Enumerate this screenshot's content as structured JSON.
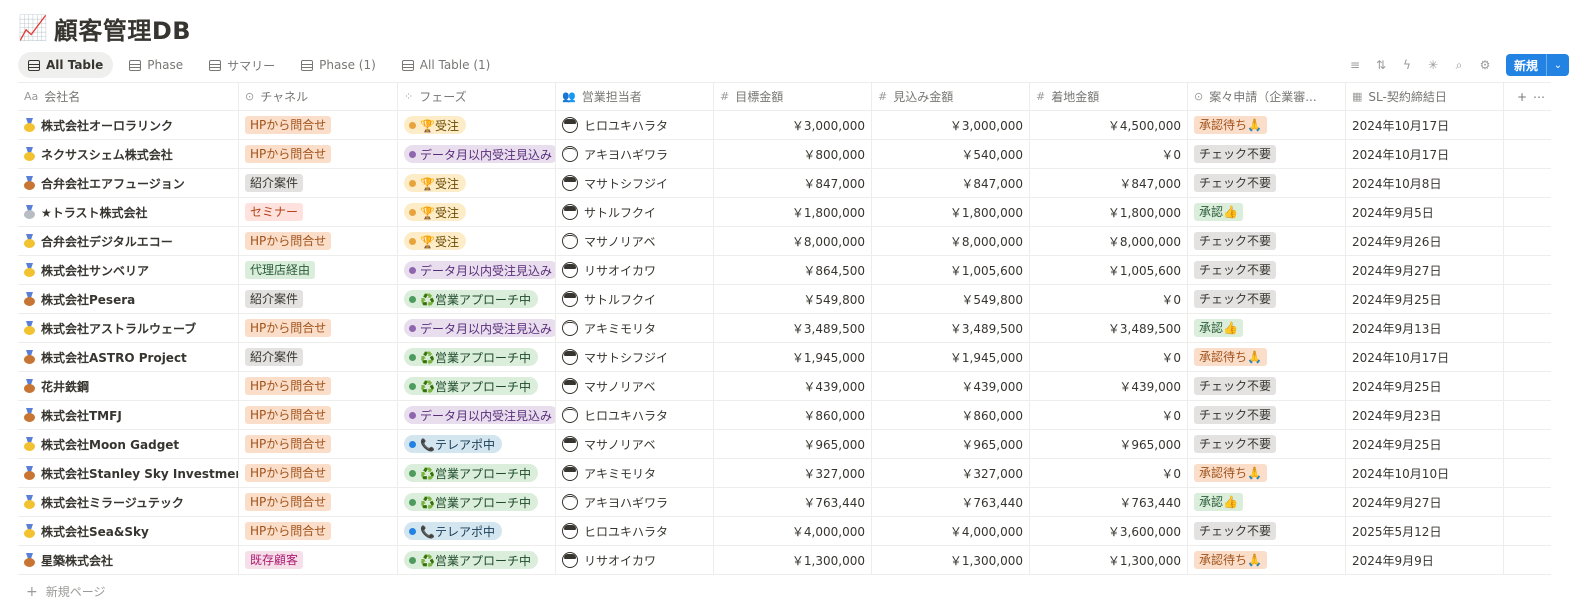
{
  "page": {
    "title_emoji": "📈",
    "title": "顧客管理DB"
  },
  "tabs": [
    {
      "label": "All Table",
      "active": true
    },
    {
      "label": "Phase",
      "active": false
    },
    {
      "label": "サマリー",
      "active": false
    },
    {
      "label": "Phase (1)",
      "active": false
    },
    {
      "label": "All Table (1)",
      "active": false
    }
  ],
  "toolbar": {
    "new_label": "新規",
    "icons": [
      "filter-icon",
      "sort-icon",
      "automation-icon",
      "ai-icon",
      "search-icon",
      "settings-icon"
    ]
  },
  "columns": [
    {
      "label": "会社名",
      "icon": "Aa"
    },
    {
      "label": "チャネル",
      "icon": "⊙"
    },
    {
      "label": "フェーズ",
      "icon": "⁘"
    },
    {
      "label": "営業担当者",
      "icon": "👥"
    },
    {
      "label": "目標金額",
      "icon": "#"
    },
    {
      "label": "見込み金額",
      "icon": "#"
    },
    {
      "label": "着地金額",
      "icon": "#"
    },
    {
      "label": "案々申請（企業審...",
      "icon": "⊙"
    },
    {
      "label": "SL-契約締結日",
      "icon": "▦"
    }
  ],
  "colors": {
    "channel": {
      "HPから問合せ": [
        "#fadec9",
        "#a0521b"
      ],
      "紹介案件": [
        "#e3e2e0",
        "#37352f"
      ],
      "セミナー": [
        "#ffe2dd",
        "#b4451c"
      ],
      "代理店経由": [
        "#dbeddb",
        "#2b5d38"
      ],
      "既存顧客": [
        "#f5e0e9",
        "#ad1a72"
      ]
    },
    "phase": {
      "受注": [
        "#fdecc8",
        "#6b4a00",
        "#e8a33c"
      ],
      "データ月以内受注見込み": [
        "#e8deee",
        "#5a2d7a",
        "#9065b0"
      ],
      "営業アプローチ中": [
        "#dbeddb",
        "#1e4a2a",
        "#4d9b5d"
      ],
      "テレアポ中": [
        "#d3e5ef",
        "#183b56",
        "#2383e2"
      ]
    },
    "approval": {
      "承認待ち🙏": [
        "#fadec9",
        "#a0521b"
      ],
      "チェック不要": [
        "#e3e2e0",
        "#37352f"
      ],
      "承認👍": [
        "#dbeddb",
        "#2b5d38"
      ]
    }
  },
  "rows": [
    {
      "medal": "gold",
      "company": "株式会社オーロラリンク",
      "channel": "HPから問合せ",
      "phase_key": "受注",
      "phase_label": "🏆受注",
      "rep": "ヒロユキハラタ",
      "target": "￥3,000,000",
      "forecast": "￥3,000,000",
      "landing": "￥4,500,000",
      "approval": "承認待ち🙏",
      "date": "2024年10月17日"
    },
    {
      "medal": "gold",
      "company": "ネクサスシェム株式会社",
      "channel": "HPから問合せ",
      "phase_key": "データ月以内受注見込み",
      "phase_label": "データ月以内受注見込み",
      "rep": "アキヨハギワラ",
      "target": "￥800,000",
      "forecast": "￥540,000",
      "landing": "￥0",
      "approval": "チェック不要",
      "date": "2024年10月17日"
    },
    {
      "medal": "bronze",
      "company": "合弁会社エアフュージョン",
      "channel": "紹介案件",
      "phase_key": "受注",
      "phase_label": "🏆受注",
      "rep": "マサトシフジイ",
      "target": "￥847,000",
      "forecast": "￥847,000",
      "landing": "￥847,000",
      "approval": "チェック不要",
      "date": "2024年10月8日"
    },
    {
      "medal": "silver",
      "company": "★トラスト株式会社",
      "channel": "セミナー",
      "phase_key": "受注",
      "phase_label": "🏆受注",
      "rep": "サトルフクイ",
      "target": "￥1,800,000",
      "forecast": "￥1,800,000",
      "landing": "￥1,800,000",
      "approval": "承認👍",
      "date": "2024年9月5日"
    },
    {
      "medal": "gold",
      "company": "合弁会社デジタルエコー",
      "channel": "HPから問合せ",
      "phase_key": "受注",
      "phase_label": "🏆受注",
      "rep": "マサノリアベ",
      "target": "￥8,000,000",
      "forecast": "￥8,000,000",
      "landing": "￥8,000,000",
      "approval": "チェック不要",
      "date": "2024年9月26日"
    },
    {
      "medal": "gold",
      "company": "株式会社サンベリア",
      "channel": "代理店経由",
      "phase_key": "データ月以内受注見込み",
      "phase_label": "データ月以内受注見込み",
      "rep": "リサオイカワ",
      "target": "￥864,500",
      "forecast": "￥1,005,600",
      "landing": "￥1,005,600",
      "approval": "チェック不要",
      "date": "2024年9月27日"
    },
    {
      "medal": "bronze",
      "company": "株式会社Pesera",
      "channel": "紹介案件",
      "phase_key": "営業アプローチ中",
      "phase_label": "♻️営業アプローチ中",
      "rep": "サトルフクイ",
      "target": "￥549,800",
      "forecast": "￥549,800",
      "landing": "￥0",
      "approval": "チェック不要",
      "date": "2024年9月25日"
    },
    {
      "medal": "gold",
      "company": "株式会社アストラルウェーブ",
      "channel": "HPから問合せ",
      "phase_key": "データ月以内受注見込み",
      "phase_label": "データ月以内受注見込み",
      "rep": "アキミモリタ",
      "target": "￥3,489,500",
      "forecast": "￥3,489,500",
      "landing": "￥3,489,500",
      "approval": "承認👍",
      "date": "2024年9月13日"
    },
    {
      "medal": "bronze",
      "company": "株式会社ASTRO Project",
      "channel": "紹介案件",
      "phase_key": "営業アプローチ中",
      "phase_label": "♻️営業アプローチ中",
      "rep": "マサトシフジイ",
      "target": "￥1,945,000",
      "forecast": "￥1,945,000",
      "landing": "￥0",
      "approval": "承認待ち🙏",
      "date": "2024年10月17日"
    },
    {
      "medal": "bronze",
      "company": "花井鉄鋼",
      "channel": "HPから問合せ",
      "phase_key": "営業アプローチ中",
      "phase_label": "♻️営業アプローチ中",
      "rep": "マサノリアベ",
      "target": "￥439,000",
      "forecast": "￥439,000",
      "landing": "￥439,000",
      "approval": "チェック不要",
      "date": "2024年9月25日"
    },
    {
      "medal": "bronze",
      "company": "株式会社TMFJ",
      "channel": "HPから問合せ",
      "phase_key": "データ月以内受注見込み",
      "phase_label": "データ月以内受注見込み",
      "rep": "ヒロユキハラタ",
      "target": "￥860,000",
      "forecast": "￥860,000",
      "landing": "￥0",
      "approval": "チェック不要",
      "date": "2024年9月23日"
    },
    {
      "medal": "gold",
      "company": "株式会社Moon Gadget",
      "channel": "HPから問合せ",
      "phase_key": "テレアポ中",
      "phase_label": "📞テレアポ中",
      "rep": "マサノリアベ",
      "target": "￥965,000",
      "forecast": "￥965,000",
      "landing": "￥965,000",
      "approval": "チェック不要",
      "date": "2024年9月25日"
    },
    {
      "medal": "bronze",
      "company": "株式会社Stanley Sky Investment",
      "channel": "HPから問合せ",
      "phase_key": "営業アプローチ中",
      "phase_label": "♻️営業アプローチ中",
      "rep": "アキミモリタ",
      "target": "￥327,000",
      "forecast": "￥327,000",
      "landing": "￥0",
      "approval": "承認待ち🙏",
      "date": "2024年10月10日"
    },
    {
      "medal": "gold",
      "company": "株式会社ミラージュテック",
      "channel": "HPから問合せ",
      "phase_key": "営業アプローチ中",
      "phase_label": "♻️営業アプローチ中",
      "rep": "アキヨハギワラ",
      "target": "￥763,440",
      "forecast": "￥763,440",
      "landing": "￥763,440",
      "approval": "承認👍",
      "date": "2024年9月27日"
    },
    {
      "medal": "gold",
      "company": "株式会社Sea&Sky",
      "channel": "HPから問合せ",
      "phase_key": "テレアポ中",
      "phase_label": "📞テレアポ中",
      "rep": "ヒロユキハラタ",
      "target": "￥4,000,000",
      "forecast": "￥4,000,000",
      "landing": "￥3,600,000",
      "approval": "チェック不要",
      "date": "2025年5月12日"
    },
    {
      "medal": "bronze",
      "company": "星築株式会社",
      "channel": "既存顧客",
      "phase_key": "営業アプローチ中",
      "phase_label": "♻️営業アプローチ中",
      "rep": "リサオイカワ",
      "target": "￥1,300,000",
      "forecast": "￥1,300,000",
      "landing": "￥1,300,000",
      "approval": "承認待ち🙏",
      "date": "2024年9月9日"
    }
  ],
  "footer": {
    "new_page_label": "新規ページ"
  }
}
